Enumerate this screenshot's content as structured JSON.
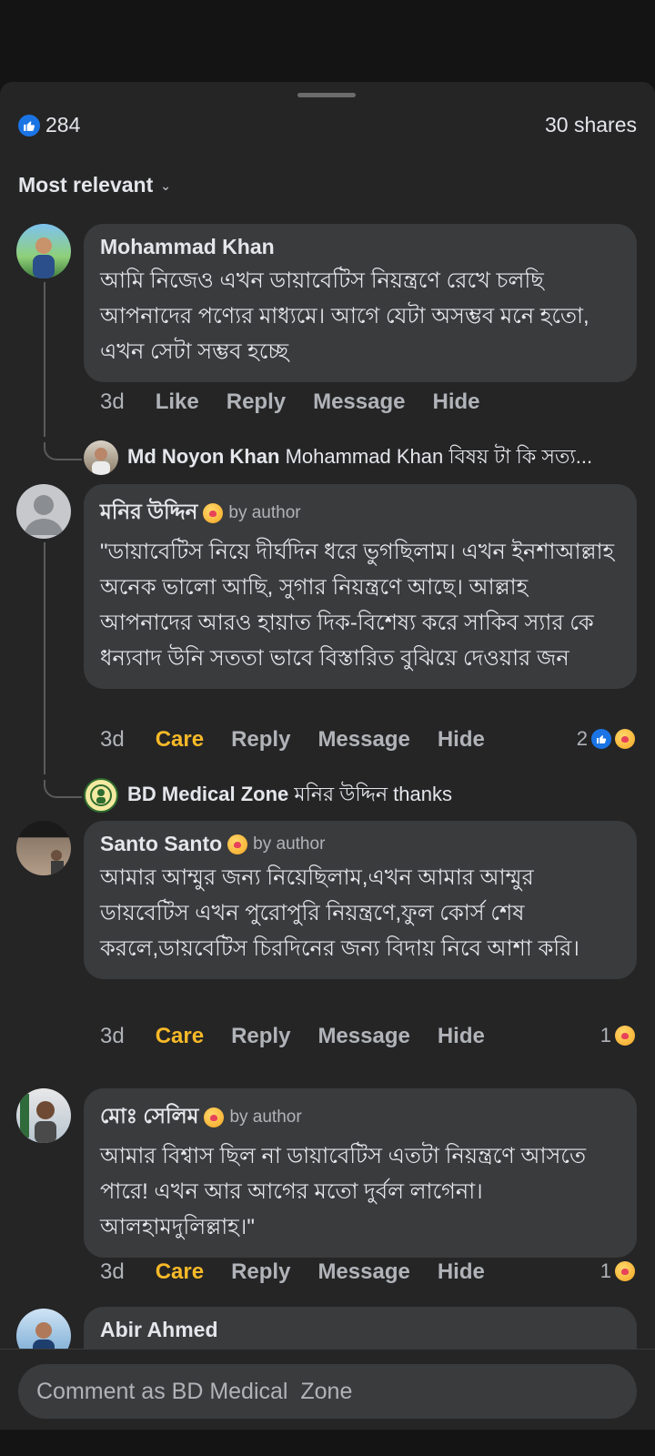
{
  "header": {
    "reaction_count": "284",
    "shares": "30 shares"
  },
  "sort": {
    "label": "Most relevant"
  },
  "comments": [
    {
      "author": "Mohammad Khan",
      "text": "আমি নিজেও এখন ডায়াবেটিস নিয়ন্ত্রণে রেখে চলছি আপনাদের পণ্যের মাধ্যমে। আগে যেটা অসম্ভব মনে হতো, এখন সেটা সম্ভব হচ্ছে",
      "time": "3d",
      "like": "Like",
      "reply": "Reply",
      "message": "Message",
      "hide": "Hide",
      "reply_preview": {
        "author": "Md Noyon Khan",
        "text": "Mohammad Khan বিষয় টা কি সত্য..."
      }
    },
    {
      "author": "মনির উদ্দিন",
      "badge": "by author",
      "text": "\"ডায়াবেটিস নিয়ে দীর্ঘদিন ধরে ভুগছিলাম। এখন ইনশাআল্লাহ অনেক ভালো আছি, সুগার নিয়ন্ত্রণে আছে। আল্লাহ আপনাদের আরও হায়াত দিক-বিশেষ্য করে সাকিব স্যার কে ধন্যবাদ উনি সততা ভাবে বিস্তারিত বুঝিয়ে দেওয়ার জন",
      "time": "3d",
      "care": "Care",
      "reply": "Reply",
      "message": "Message",
      "hide": "Hide",
      "reaction_count": "2",
      "reply_preview": {
        "author": "BD Medical  Zone",
        "text": "মনির উদ্দিন thanks"
      }
    },
    {
      "author": "Santo Santo",
      "badge": "by author",
      "text": "আমার আম্মুর জন্য নিয়েছিলাম,এখন আমার আম্মুর ডায়বেটিস এখন পুরোপুরি নিয়ন্ত্রণে,ফুল কোর্স শেষ করলে,ডায়বেটিস চিরদিনের জন্য বিদায় নিবে আশা করি।",
      "time": "3d",
      "care": "Care",
      "reply": "Reply",
      "message": "Message",
      "hide": "Hide",
      "reaction_count": "1"
    },
    {
      "author": "মোঃ সেলিম",
      "badge": "by author",
      "text": "আমার বিশ্বাস ছিল না ডায়াবেটিস এতটা নিয়ন্ত্রণে আসতে পারে! এখন আর আগের মতো দুর্বল লাগেনা। আলহামদুলিল্লাহ।\"",
      "time": "3d",
      "care": "Care",
      "reply": "Reply",
      "message": "Message",
      "hide": "Hide",
      "reaction_count": "1"
    },
    {
      "author": "Abir Ahmed"
    }
  ],
  "composer": {
    "placeholder": "Comment as BD Medical  Zone"
  },
  "colors": {
    "background": "#252526",
    "bubble": "#3a3b3c",
    "care": "#f7b928",
    "like": "#1b74e4"
  }
}
